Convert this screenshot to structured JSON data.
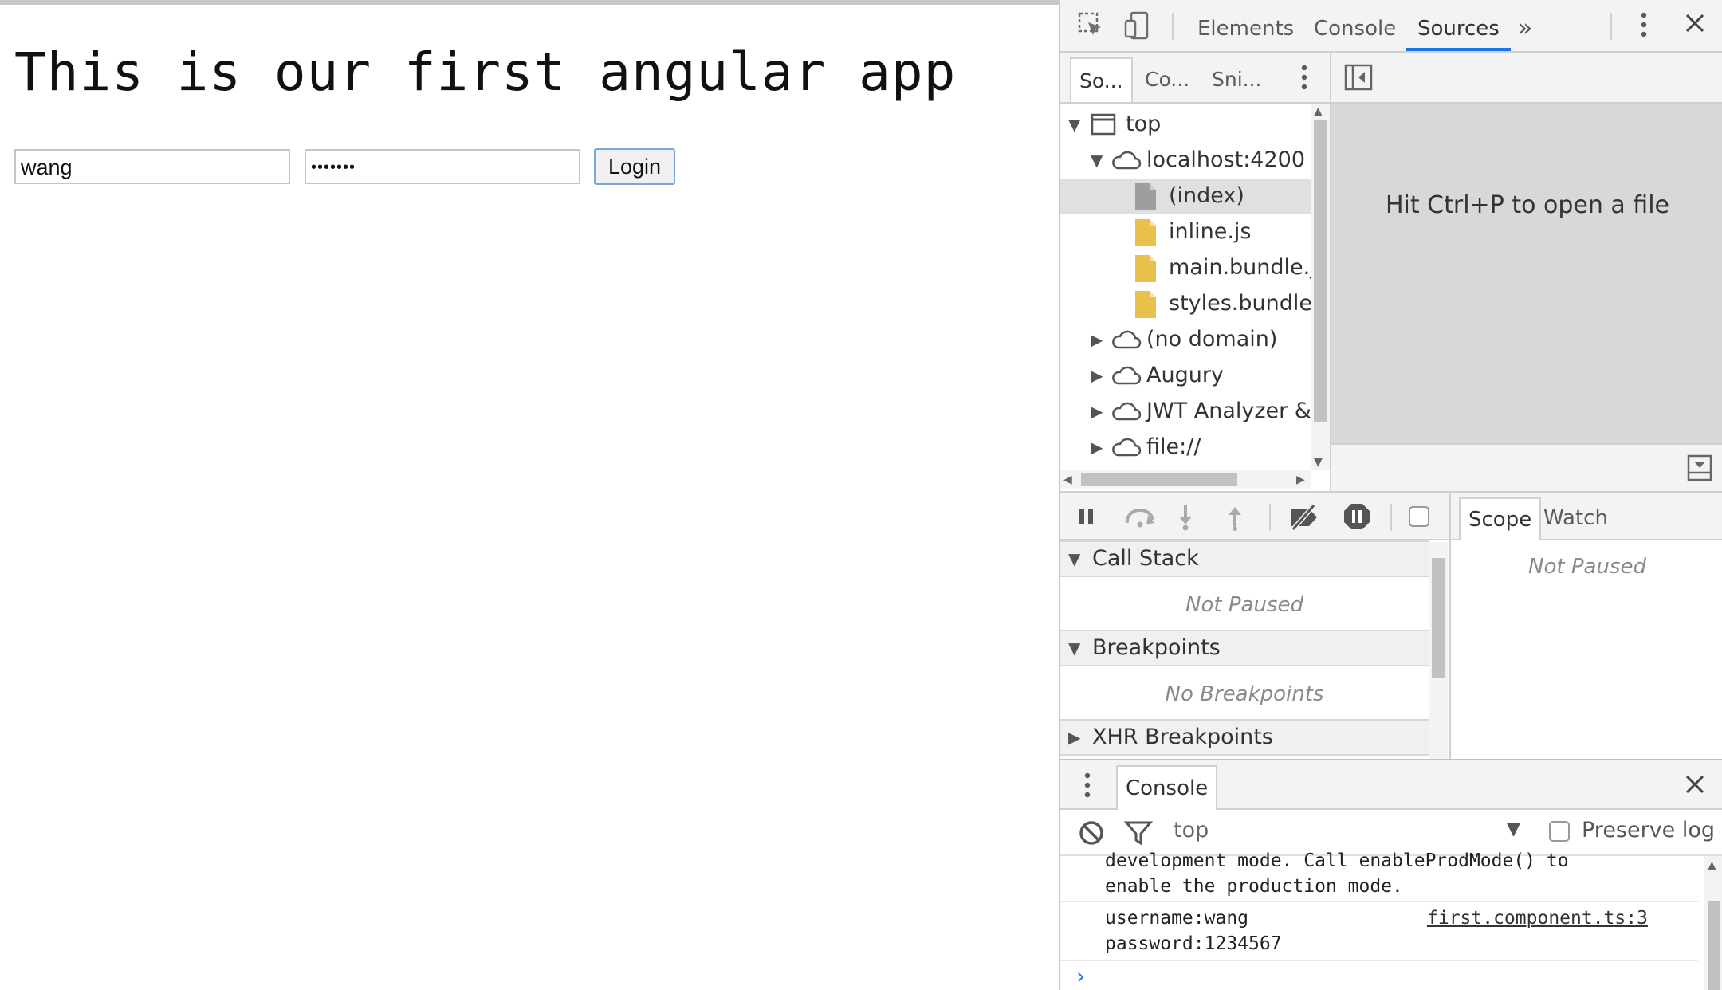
{
  "app": {
    "title": "This is our first angular app",
    "username_value": "wang",
    "password_mask": "•••••••",
    "login_label": "Login"
  },
  "devtools": {
    "tabs": [
      "Elements",
      "Console",
      "Sources"
    ],
    "active_tab": "Sources",
    "more_tabs_glyph": "»",
    "navigator_tabs": [
      "So...",
      "Co...",
      "Sni..."
    ],
    "tree": {
      "top": "top",
      "origin": "localhost:4200",
      "files": [
        "(index)",
        "inline.js",
        "main.bundle.js",
        "styles.bundle.js"
      ],
      "other_domains": [
        "(no domain)",
        "Augury",
        "JWT Analyzer & I",
        "file://"
      ]
    },
    "editor_hint": "Hit Ctrl+P to open a file",
    "sections": {
      "call_stack": "Call Stack",
      "call_stack_empty": "Not Paused",
      "breakpoints": "Breakpoints",
      "breakpoints_empty": "No Breakpoints",
      "xhr_breakpoints": "XHR Breakpoints"
    },
    "scope_tabs": [
      "Scope",
      "Watch"
    ],
    "scope_empty": "Not Paused",
    "drawer": {
      "tab": "Console",
      "context": "top",
      "preserve_log": "Preserve log",
      "messages": [
        {
          "lines": [
            "development mode. Call enableProdMode() to",
            "enable the production mode."
          ],
          "source": ""
        },
        {
          "lines": [
            "username:wang",
            "password:1234567"
          ],
          "source": "first.component.ts:3"
        }
      ],
      "prompt": "›"
    }
  },
  "colors": {
    "accent": "#1a73e8",
    "folder_file": "#e8c04a",
    "index_file": "#9e9e9e"
  }
}
